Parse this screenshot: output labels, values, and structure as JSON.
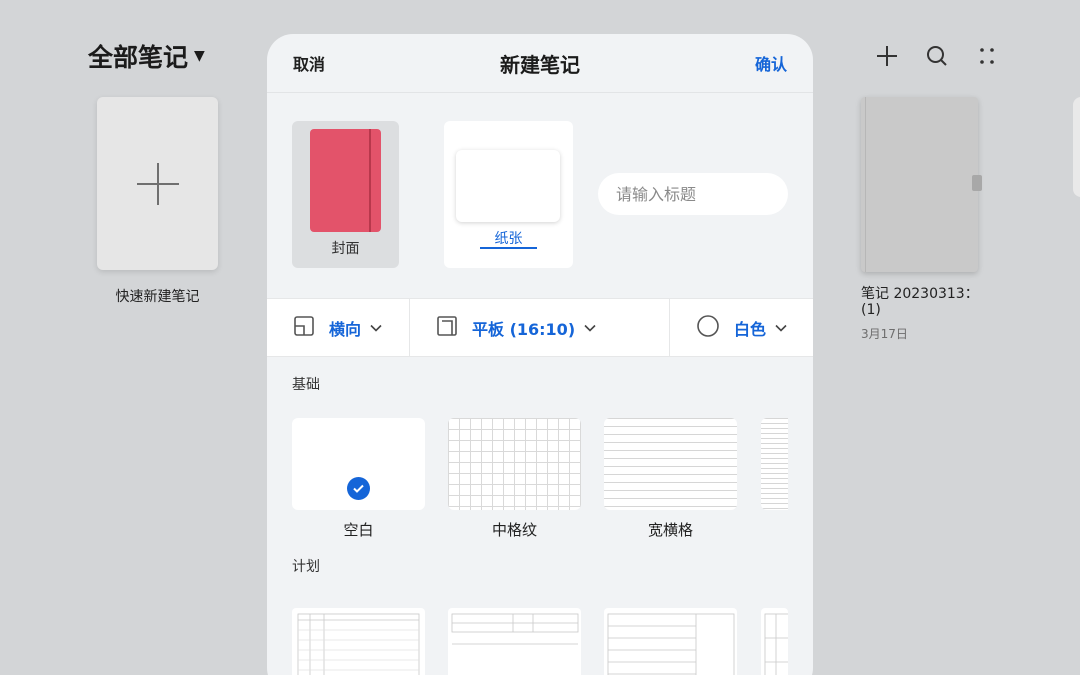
{
  "background": {
    "page_title": "全部笔记",
    "quick_new_label": "快速新建笔记",
    "note": {
      "title": "笔记 20230313：(1)",
      "date": "3月17日",
      "cover_color": "#c9c9c9"
    },
    "top_icons": [
      "plus-icon",
      "search-icon",
      "more-dots-icon"
    ]
  },
  "modal": {
    "cancel_label": "取消",
    "title": "新建笔记",
    "confirm_label": "确认",
    "cover_label": "封面",
    "cover_color": "#e3536a",
    "paper_label": "纸张",
    "title_input": {
      "placeholder": "请输入标题",
      "value": ""
    },
    "options": {
      "orientation": "横向",
      "size": "平板 (16:10)",
      "color": "白色"
    },
    "sections": {
      "basic": {
        "title": "基础",
        "templates": [
          {
            "label": "空白",
            "selected": true
          },
          {
            "label": "中格纹",
            "selected": false
          },
          {
            "label": "宽横格",
            "selected": false
          }
        ]
      },
      "plan": {
        "title": "计划"
      }
    },
    "accent_color": "#1565d8"
  }
}
